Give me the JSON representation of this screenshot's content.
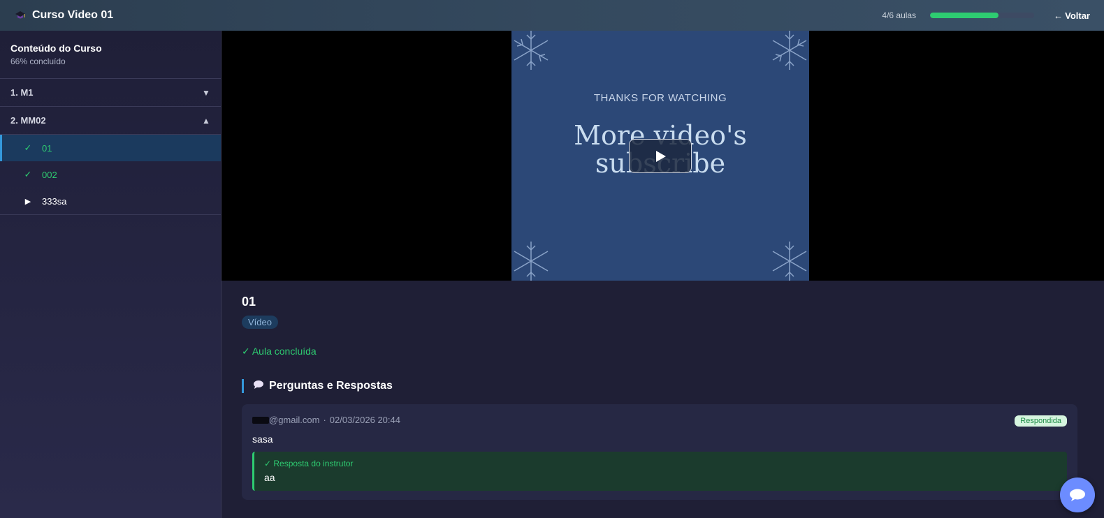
{
  "header": {
    "icon": "graduation-cap-icon",
    "title": "Curso Video 01",
    "progress_text": "4/6 aulas",
    "progress_fraction": 0.66,
    "back_label": "Voltar",
    "back_icon": "arrow-left-icon"
  },
  "sidebar": {
    "title": "Conteúdo do Curso",
    "subtitle": "66% concluído",
    "modules": [
      {
        "label": "1. M1",
        "state": "collapsed",
        "arrow": "▼"
      },
      {
        "label": "2. MM02",
        "state": "expanded",
        "arrow": "▲"
      }
    ],
    "lessons": [
      {
        "label": "01",
        "status": "done",
        "mark": "✓"
      },
      {
        "label": "002",
        "status": "done",
        "mark": "✓"
      },
      {
        "label": "333sa",
        "status": "pending",
        "mark": "▶"
      }
    ]
  },
  "video": {
    "slide_top": "THANKS FOR WATCHING",
    "slide_line1": "More video's",
    "slide_line2": "subscribe",
    "play_icon": "play-icon"
  },
  "lesson": {
    "title": "01",
    "type": "Vídeo",
    "completed_text": "✓ Aula concluída"
  },
  "qa": {
    "title": "Perguntas e Respostas",
    "icon": "speech-bubble-icon",
    "items": [
      {
        "email_suffix": "@gmail.com",
        "separator": "·",
        "datetime": "02/03/2026 20:44",
        "status": "Respondida",
        "question": "sasa",
        "answer_label": "✓ Resposta do instrutor",
        "answer": "aa"
      }
    ]
  },
  "colors": {
    "accent": "#3498db",
    "success": "#2ecc71",
    "header_bg": "#2c3e50",
    "chat_fab": "#6c8cff"
  }
}
